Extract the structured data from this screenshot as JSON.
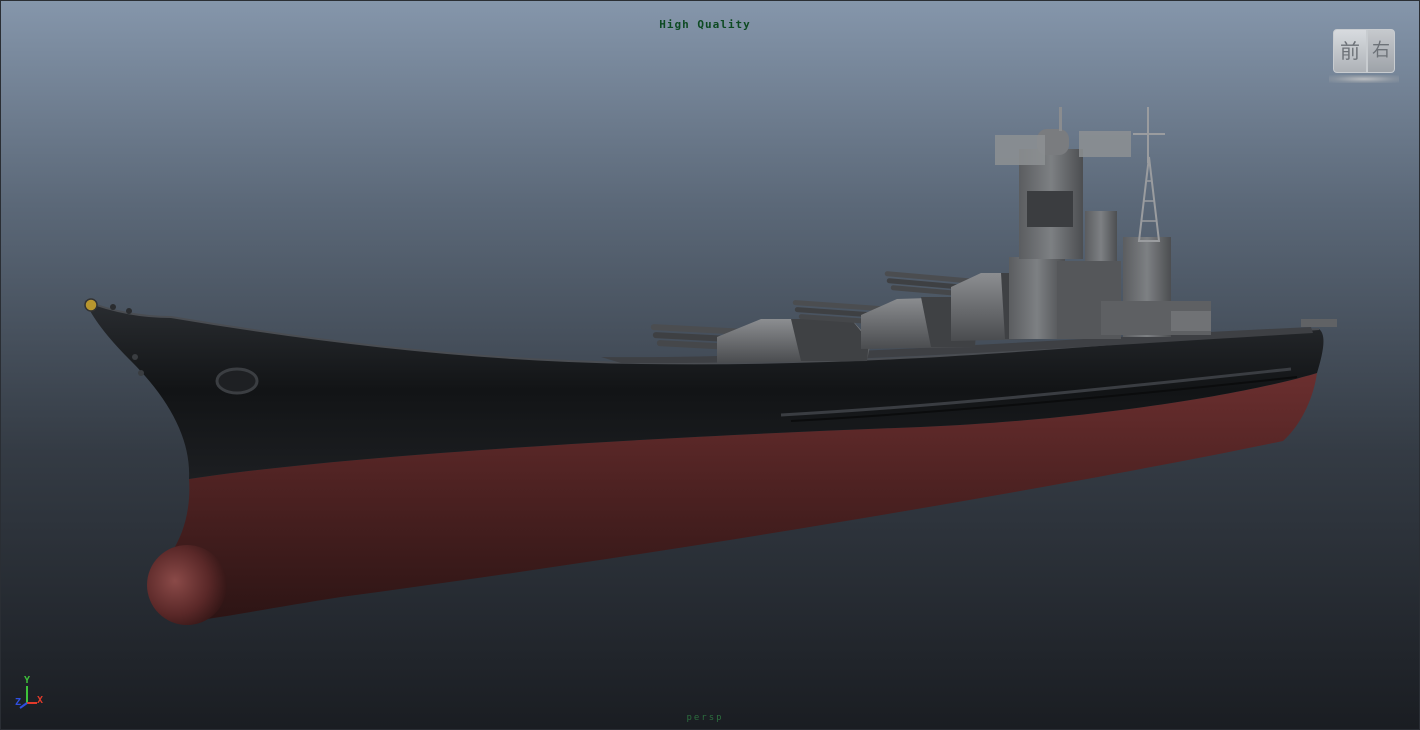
{
  "viewport": {
    "quality_label": "High Quality",
    "camera_label": "persp"
  },
  "viewcube": {
    "front_label": "前",
    "right_label": "右"
  },
  "axis_indicator": {
    "y_label": "Y",
    "z_label": "Z",
    "x_label": "X",
    "x_color": "#e23a2a",
    "y_color": "#3ec23a",
    "z_color": "#2f4fe0"
  },
  "model": {
    "hull_top_color": "#15171a",
    "hull_bottom_color": "#5a2626",
    "superstructure_color": "#6b6d70"
  }
}
